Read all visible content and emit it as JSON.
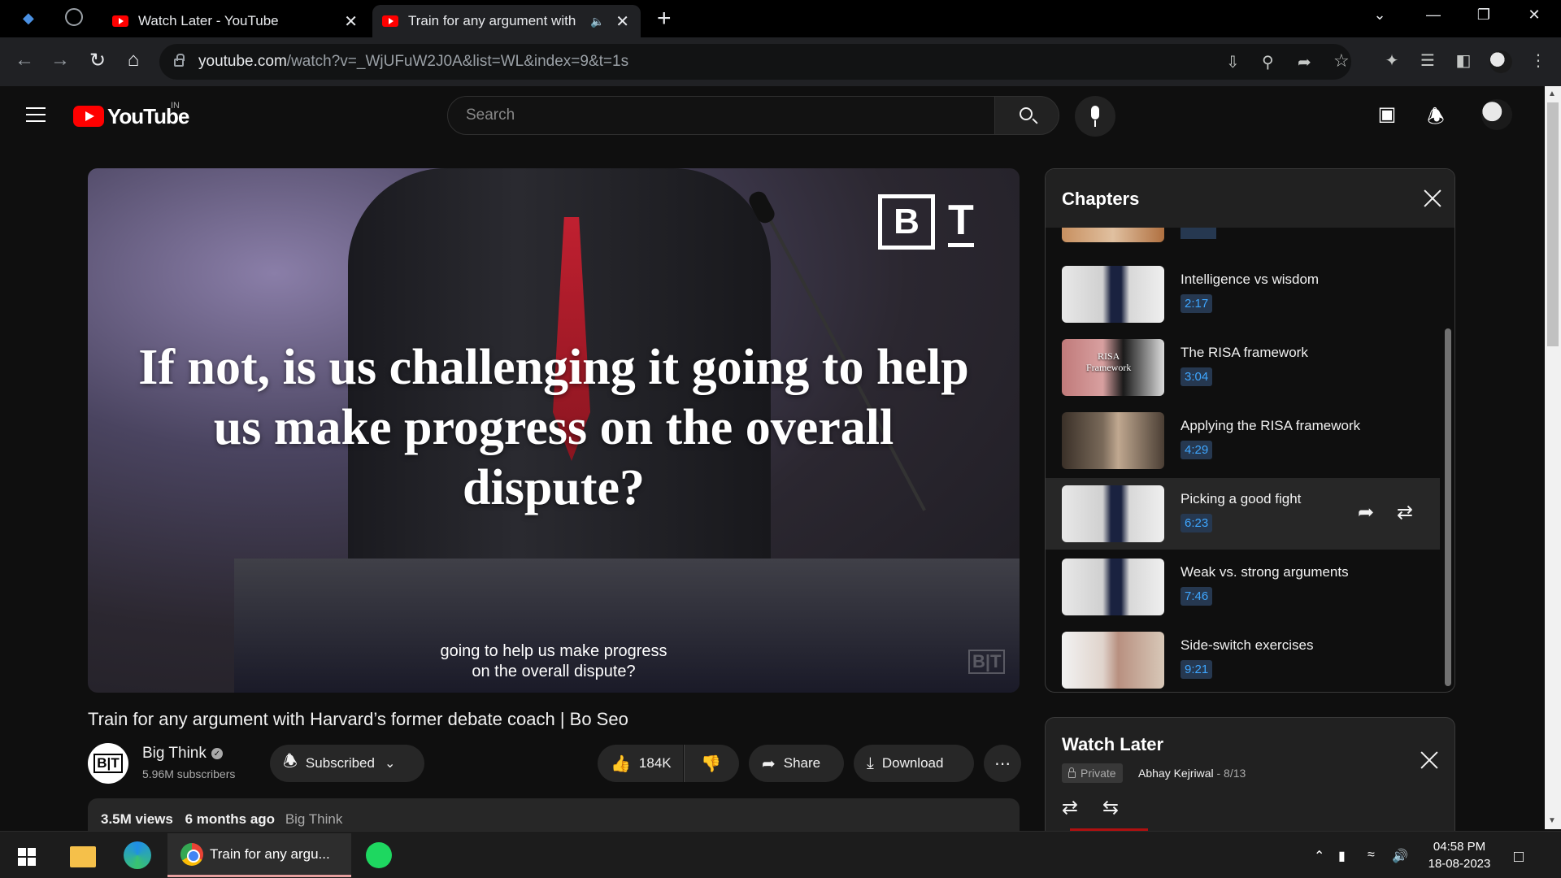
{
  "browser": {
    "tabs": [
      {
        "label": "Watch Later - YouTube",
        "active": false
      },
      {
        "label": "Train for any argument with Harvard's former debate coach",
        "active": true
      }
    ],
    "url_host": "youtube.com",
    "url_path": "/watch?v=_WjUFuW2J0A&list=WL&index=9&t=1s"
  },
  "masthead": {
    "logo_text": "YouTube",
    "country_code": "IN",
    "search_placeholder": "Search"
  },
  "video": {
    "overlay_text": "If not, is us challenging it going to help us make progress on the overall dispute?",
    "captions_line1": "going to help us make progress",
    "captions_line2": "on the overall dispute?",
    "brand_b": "B",
    "brand_t": "T",
    "title": "Train for any argument with Harvard’s former debate coach | Bo Seo"
  },
  "channel": {
    "avatar_text": "B|T",
    "name": "Big Think",
    "subscribers": "5.96M subscribers",
    "subscribe_label": "Subscribed"
  },
  "actions": {
    "likes": "184K",
    "share": "Share",
    "download": "Download"
  },
  "description": {
    "views": "3.5M views",
    "ago": "6 months ago",
    "tag": "Big Think"
  },
  "chapters": {
    "title": "Chapters",
    "items": [
      {
        "name": "Intelligence vs wisdom",
        "time": "2:17",
        "thumb": "studio"
      },
      {
        "name": "The RISA framework",
        "time": "3:04",
        "thumb": "risa",
        "thumb_label": "RISA\nFramework"
      },
      {
        "name": "Applying the RISA framework",
        "time": "4:29",
        "thumb": "old"
      },
      {
        "name": "Picking a good fight",
        "time": "6:23",
        "thumb": "studio",
        "active": true
      },
      {
        "name": "Weak vs. strong arguments",
        "time": "7:46",
        "thumb": "studio"
      },
      {
        "name": "Side-switch exercises",
        "time": "9:21",
        "thumb": "book"
      }
    ]
  },
  "watch_later": {
    "title": "Watch Later",
    "privacy": "Private",
    "owner": "Abhay Kejriwal",
    "position": " - 8/13"
  },
  "taskbar": {
    "chrome_label": "Train for any argu...",
    "time": "04:58 PM",
    "date": "18-08-2023"
  }
}
